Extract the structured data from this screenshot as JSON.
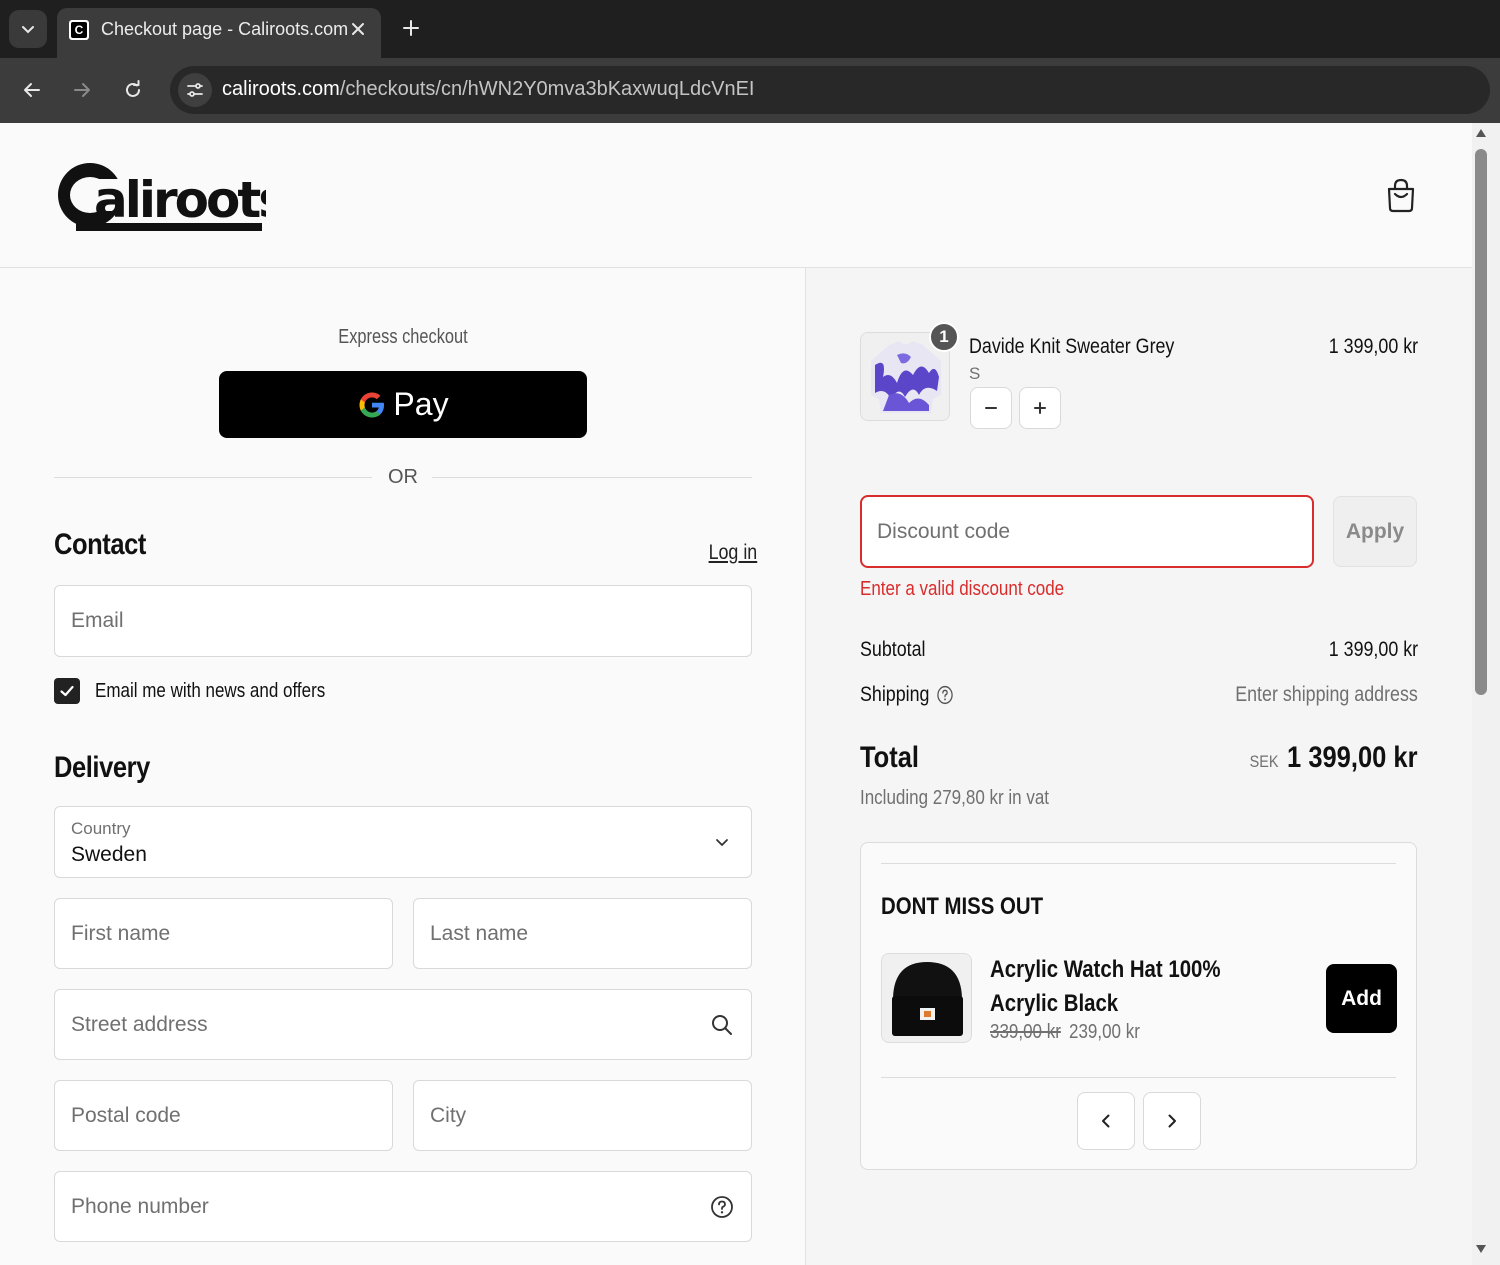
{
  "browser": {
    "tab_title": "Checkout page - Caliroots.com",
    "favicon_letter": "C",
    "url_host": "caliroots.com",
    "url_path": "/checkouts/cn/hWN2Y0mva3bKaxwuqLdcVnEI"
  },
  "header": {
    "logo_text": "Caliroots"
  },
  "express": {
    "label": "Express checkout",
    "gpay_label": "Pay",
    "or_label": "OR"
  },
  "contact": {
    "heading": "Contact",
    "login_link": "Log in",
    "email_placeholder": "Email",
    "newsletter_label": "Email me with news and offers",
    "newsletter_checked": true
  },
  "delivery": {
    "heading": "Delivery",
    "country_label": "Country",
    "country_value": "Sweden",
    "first_name_placeholder": "First name",
    "last_name_placeholder": "Last name",
    "street_placeholder": "Street address",
    "postal_placeholder": "Postal code",
    "city_placeholder": "City",
    "phone_placeholder": "Phone number"
  },
  "order": {
    "item": {
      "quantity": "1",
      "name": "Davide Knit Sweater Grey",
      "variant": "S",
      "price": "1 399,00 kr"
    },
    "discount_placeholder": "Discount code",
    "apply_label": "Apply",
    "discount_error": "Enter a valid discount code",
    "subtotal_label": "Subtotal",
    "subtotal_value": "1 399,00 kr",
    "shipping_label": "Shipping",
    "shipping_value": "Enter shipping address",
    "total_label": "Total",
    "total_currency": "SEK",
    "total_value": "1 399,00 kr",
    "vat_text": "Including 279,80 kr in vat"
  },
  "upsell": {
    "title": "DONT MISS OUT",
    "product_name": "Acrylic Watch Hat 100% Acrylic Black",
    "old_price": "339,00 kr",
    "new_price": "239,00 kr",
    "add_label": "Add"
  },
  "colors": {
    "error": "#d92c2c",
    "button_dark": "#000000",
    "chrome_dark": "#1f1f1f"
  }
}
